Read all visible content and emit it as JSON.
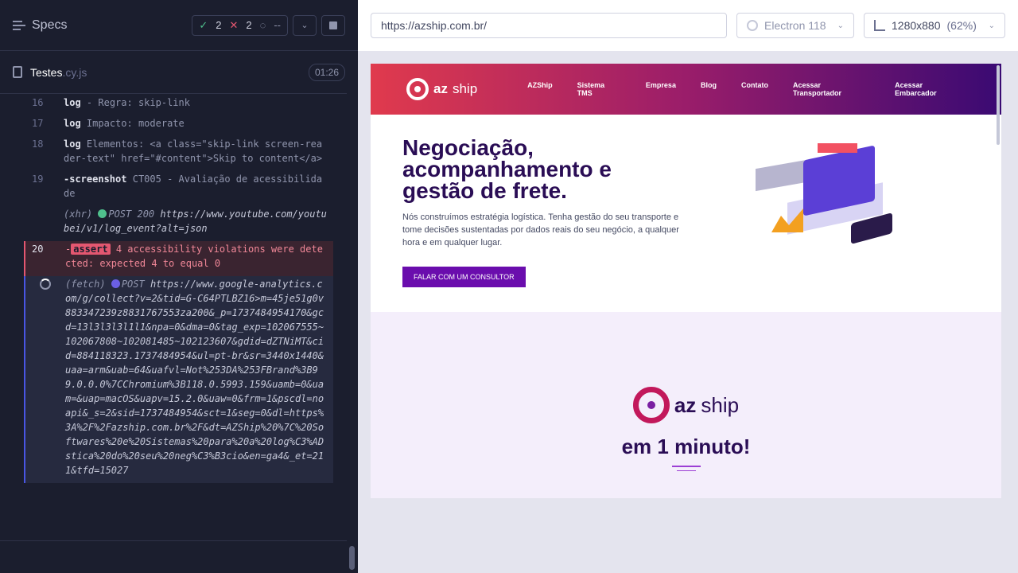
{
  "left": {
    "specs_title": "Specs",
    "stats": {
      "passed": "2",
      "failed": "2",
      "pending": "--"
    },
    "file": {
      "name": "Testes",
      "ext": ".cy.js",
      "time": "01:26"
    },
    "log": [
      {
        "num": "16",
        "cmd": "log",
        "text": "- Regra: skip-link"
      },
      {
        "num": "17",
        "cmd": "log",
        "text": "Impacto: moderate"
      },
      {
        "num": "18",
        "cmd": "log",
        "text": "Elementos: <a class=\"skip-link screen-reader-text\" href=\"#content\">Skip to content</a>"
      },
      {
        "num": "19",
        "cmd": "-screenshot",
        "text": "CT005 - Avaliação de acessibilidade"
      }
    ],
    "xhr": {
      "kind": "(xhr)",
      "method": "POST 200",
      "url": "https://www.youtube.com/youtubei/v1/log_event?alt=json"
    },
    "assert": {
      "num": "20",
      "dash": "-",
      "badge": "assert",
      "text": "4 accessibility violations were detected: expected 4 to equal 0"
    },
    "fetch": {
      "kind": "(fetch)",
      "method": "POST",
      "url": "https://www.google-analytics.com/g/collect?v=2&tid=G-C64PTLBZ16>m=45je51g0v883347239z8831767553za200&_p=1737484954170&gcd=13l3l3l3l1l1&npa=0&dma=0&tag_exp=102067555~102067808~102081485~102123607&gdid=dZTNiMT&cid=884118323.1737484954&ul=pt-br&sr=3440x1440&uaa=arm&uab=64&uafvl=Not%253DA%253FBrand%3B99.0.0.0%7CChromium%3B118.0.5993.159&uamb=0&uam=&uap=macOS&uapv=15.2.0&uaw=0&frm=1&pscdl=noapi&_s=2&sid=1737484954&sct=1&seg=0&dl=https%3A%2F%2Fazship.com.br%2F&dt=AZShip%20%7C%20Softwares%20e%20Sistemas%20para%20a%20log%C3%ADstica%20do%20seu%20neg%C3%B3cio&en=ga4&_et=211&tfd=15027"
    }
  },
  "right": {
    "url": "https://azship.com.br/",
    "browser": "Electron 118",
    "viewport": "1280x880",
    "zoom": "(62%)",
    "site": {
      "logo_bold": "az",
      "logo_light": "ship",
      "nav": [
        "AZShip",
        "Sistema TMS",
        "Empresa",
        "Blog",
        "Contato",
        "Acessar Transportador",
        "Acessar Embarcador"
      ],
      "hero_title_1": "Negociação,",
      "hero_title_2": "acompanhamento e",
      "hero_title_3": "gestão de frete.",
      "hero_sub": "Nós construímos estratégia logística. Tenha gestão do seu transporte e tome decisões sustentadas por dados reais do seu negócio, a qualquer hora e em qualquer lugar.",
      "cta": "FALAR COM UM CONSULTOR",
      "minuto": "em 1 minuto!"
    }
  }
}
